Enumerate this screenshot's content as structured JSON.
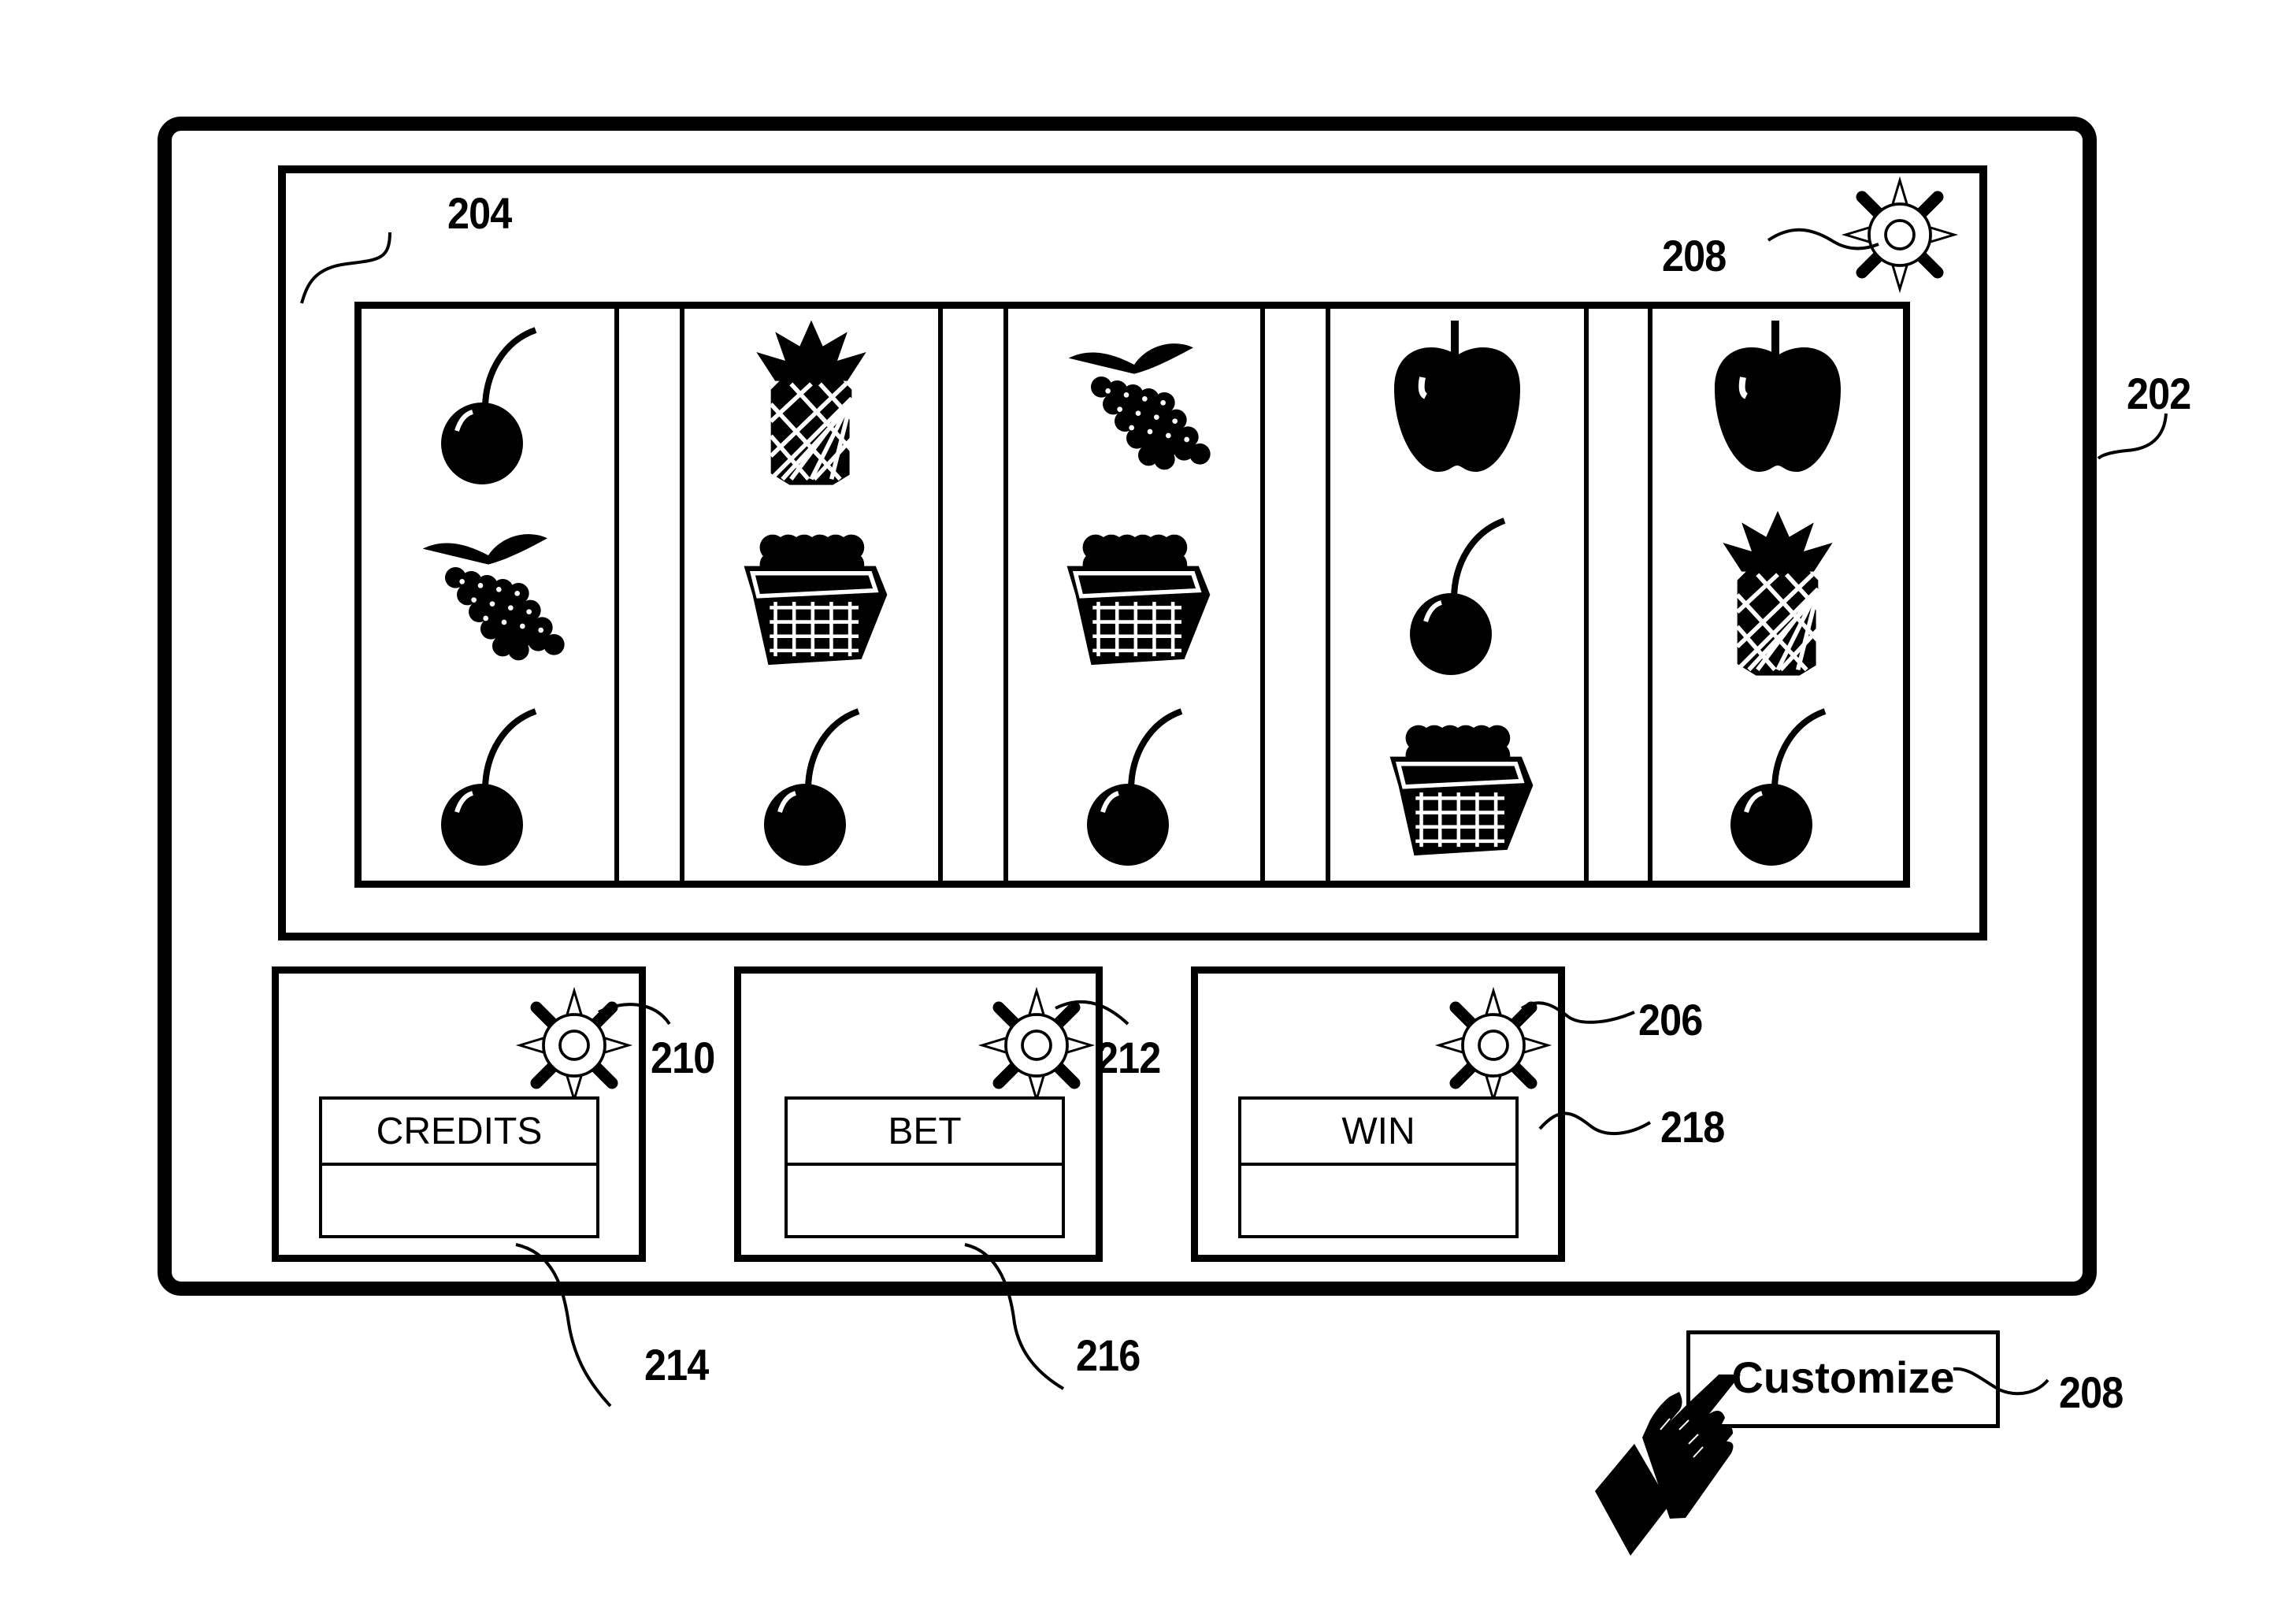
{
  "figure": {
    "labels": {
      "device": "202",
      "reels": "204",
      "win_settings_icon": "206",
      "main_settings_icon": "208",
      "credits_settings_icon": "210",
      "bet_settings_icon": "212",
      "credits_meter": "214",
      "bet_meter": "216",
      "win_meter": "218",
      "customize_button": "208"
    }
  },
  "reels": [
    {
      "symbols": [
        "cherry",
        "grapes",
        "cherry"
      ]
    },
    {
      "symbols": [
        "pineapple",
        "berry-basket",
        "cherry"
      ]
    },
    {
      "symbols": [
        "grapes",
        "berry-basket",
        "cherry"
      ]
    },
    {
      "symbols": [
        "apple",
        "cherry",
        "berry-basket"
      ]
    },
    {
      "symbols": [
        "apple",
        "pineapple",
        "cherry"
      ]
    }
  ],
  "meters": [
    {
      "label": "CREDITS",
      "value": ""
    },
    {
      "label": "BET",
      "value": ""
    },
    {
      "label": "WIN",
      "value": ""
    }
  ],
  "customize": {
    "label": "Customize"
  },
  "icons": {
    "settings": "sun-gear-icon",
    "pointer": "pointing-hand-icon"
  }
}
